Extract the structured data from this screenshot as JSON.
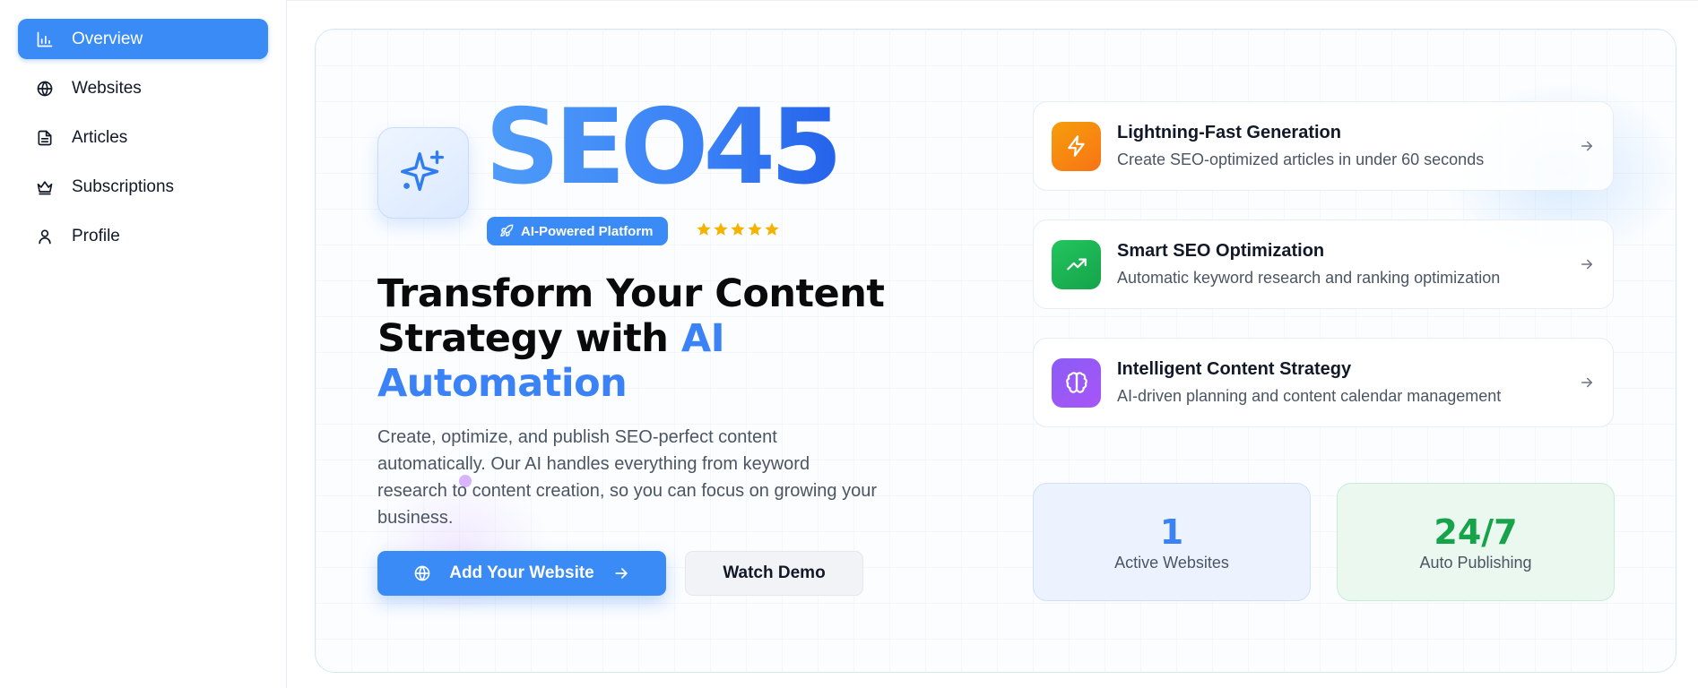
{
  "sidebar": {
    "items": [
      {
        "label": "Overview",
        "icon": "bar-chart-icon",
        "active": true
      },
      {
        "label": "Websites",
        "icon": "globe-icon"
      },
      {
        "label": "Articles",
        "icon": "document-icon"
      },
      {
        "label": "Subscriptions",
        "icon": "crown-icon"
      },
      {
        "label": "Profile",
        "icon": "user-icon"
      }
    ]
  },
  "hero": {
    "brand": "SEO45",
    "badge": "AI-Powered Platform",
    "rating_stars": 5,
    "headline_line1": "Transform Your Content",
    "headline_line2": "Strategy with ",
    "headline_accent": "AI Automation",
    "description": "Create, optimize, and publish SEO-perfect content automatically. Our AI handles everything from keyword research to content creation, so you can focus on growing your business.",
    "primary_button": "Add Your Website",
    "secondary_button": "Watch Demo"
  },
  "features": [
    {
      "title": "Lightning-Fast Generation",
      "description": "Create SEO-optimized articles in under 60 seconds",
      "icon": "lightning-icon",
      "color": "#f59e0b"
    },
    {
      "title": "Smart SEO Optimization",
      "description": "Automatic keyword research and ranking optimization",
      "icon": "trending-up-icon",
      "color": "#22c55e"
    },
    {
      "title": "Intelligent Content Strategy",
      "description": "AI-driven planning and content calendar management",
      "icon": "brain-icon",
      "color": "#8b5cf6"
    }
  ],
  "stats": [
    {
      "value": "1",
      "label": "Active Websites",
      "color": "#3b82f6"
    },
    {
      "value": "24/7",
      "label": "Auto Publishing",
      "color": "#16a34a"
    }
  ],
  "colors": {
    "accent": "#3b8bf6"
  }
}
